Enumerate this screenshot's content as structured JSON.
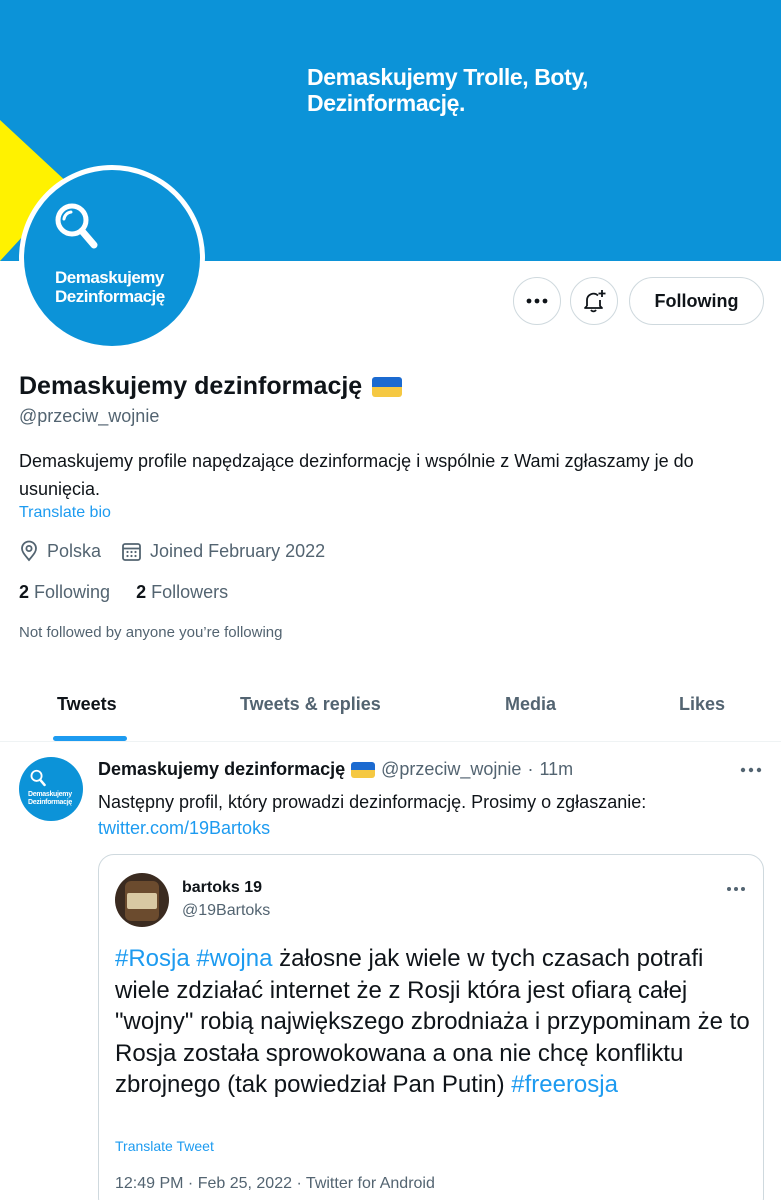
{
  "banner": {
    "line1": "Demaskujemy Trolle, Boty,",
    "line2": "Dezinformację.",
    "color": "#0c93d8",
    "accent_color": "#fff200"
  },
  "avatar": {
    "line1": "Demaskujemy",
    "line2": "Dezinformację"
  },
  "actions": {
    "more_icon": "more-icon",
    "bell_icon": "bell-plus-icon",
    "follow_label": "Following"
  },
  "profile": {
    "name": "Demaskujemy dezinformację",
    "flag": "ukraine-flag",
    "handle": "@przeciw_wojnie",
    "bio": "Demaskujemy profile napędzające dezinformację i wspólnie z Wami zgłaszamy je do usunięcia.",
    "translate_bio": "Translate bio",
    "location": "Polska",
    "joined": "Joined February 2022",
    "following_count": "2",
    "following_label": "Following",
    "followers_count": "2",
    "followers_label": "Followers",
    "not_followed": "Not followed by anyone you’re following"
  },
  "tabs": [
    {
      "label": "Tweets",
      "active": true
    },
    {
      "label": "Tweets & replies",
      "active": false
    },
    {
      "label": "Media",
      "active": false
    },
    {
      "label": "Likes",
      "active": false
    }
  ],
  "tweet": {
    "name": "Demaskujemy dezinformację",
    "handle": "@przeciw_wojnie",
    "separator": "·",
    "time": "11m",
    "text": "Następny profil, który prowadzi dezinformację. Prosimy o zgłaszanie:",
    "link": "twitter.com/19Bartoks",
    "avatar_line1": "Demaskujemy",
    "avatar_line2": "Dezinformację",
    "quote": {
      "name": "bartoks 19",
      "handle": "@19Bartoks",
      "tag1": "#Rosja",
      "tag2": "#wojna",
      "body": " żałosne jak wiele w tych czasach potrafi wiele zdziałać internet że z Rosji która jest ofiarą całej \"wojny\" robią największego zbrodniaża i przypominam że to Rosja została sprowokowana a ona nie chcę konfliktu zbrojnego (tak powiedział Pan Putin) ",
      "tag3": "#freerosja",
      "translate": "Translate Tweet",
      "timestamp": "12:49 PM · Feb 25, 2022 · Twitter for Android"
    }
  }
}
